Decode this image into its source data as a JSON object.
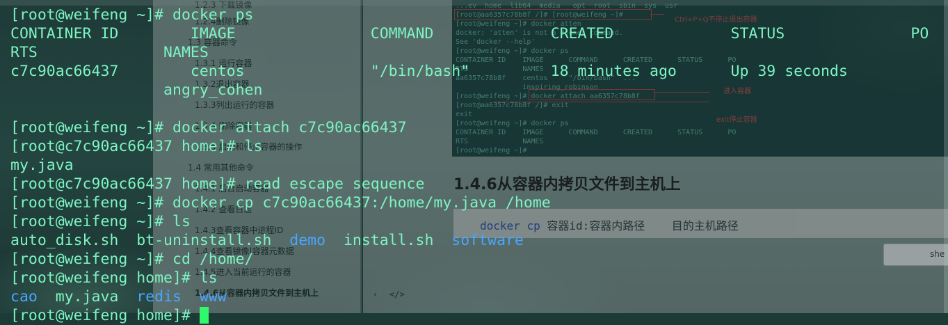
{
  "document": {
    "toc": [
      "1.2.3 下载镜像",
      "1.2.4删除镜像",
      "1.3 容器命令",
      "1.3.1 运行容器",
      "1.3.2退出容器",
      "1.3.3列出运行的容器",
      "1.3.4 删除容器",
      "1.3.5 启动和停止容器的操作",
      "1.4 常用其他命令",
      "1.4.1 后台启动容器",
      "1.4.2 查看日志",
      "1.4.3查看容器中进程ID",
      "1.4.4查看镜像|容器元数据",
      "1.4.5进入当前运行的容器",
      "1.4.6从容器内拷贝文件到主机上"
    ],
    "screenshot_lines": [
      "...ev  home  lib64  media   opt  root  sbin  sys  usr",
      "[root@aa6357c78b8f /]# [root@weifeng ~]#",
      "[root@weifeng ~]# docker atten",
      "docker: 'atten' is not a docker command.",
      "See 'docker --help'",
      "[root@weifeng ~]# docker ps",
      "CONTAINER ID    IMAGE      COMMAND      CREATED      STATUS      PO",
      "RTS             NAMES",
      "aa6357c78b8f    centos     \"/bin/bash\"  ...",
      "                inspiring_robinson",
      "[root@weifeng ~]# docker attach aa6357c78b8f",
      "[root@aa6357c78b8f /]# exit",
      "exit",
      "[root@weifeng ~]# docker ps",
      "CONTAINER ID    IMAGE      COMMAND      CREATED      STATUS      PO",
      "RTS             NAMES",
      "[root@weifeng ~]# "
    ],
    "screenshot_notes": {
      "note1": "Ctrl+P+Q不停止退出容器",
      "note2": "进入容器",
      "note3": "exit停止容器"
    },
    "heading": "1.4.6从容器内拷贝文件到主机上",
    "code": {
      "cmd": "docker",
      "sub": "cp",
      "rest": " 容器id:容器内路径    目的主机路径"
    },
    "button_label": "she",
    "footer_icons": [
      "‹",
      "</>"
    ]
  },
  "terminal": {
    "prompt_home": "[root@weifeng ~]# ",
    "lines": [
      {
        "text": "[root@weifeng ~]# docker ps"
      },
      {
        "text": "CONTAINER ID        IMAGE               COMMAND             CREATED             STATUS              PO"
      },
      {
        "text": "RTS              NAMES"
      },
      {
        "text": "c7c90ac66437        centos              \"/bin/bash\"         18 minutes ago      Up 39 seconds"
      },
      {
        "text": "                 angry_cohen"
      },
      {
        "text": ""
      },
      {
        "text": "[root@weifeng ~]# docker attach c7c90ac66437"
      },
      {
        "text": "[root@c7c90ac66437 home]# ls"
      },
      {
        "text": "my.java"
      },
      {
        "text": "[root@c7c90ac66437 home]# read escape sequence"
      },
      {
        "text": "[root@weifeng ~]# docker cp c7c90ac66437:/home/my.java /home"
      },
      {
        "text": "[root@weifeng ~]# ls"
      },
      {
        "parts": [
          {
            "text": "auto_disk.sh  bt-uninstall.sh  ",
            "dir": false
          },
          {
            "text": "demo",
            "dir": true
          },
          {
            "text": "  install.sh  ",
            "dir": false
          },
          {
            "text": "software",
            "dir": true
          }
        ]
      },
      {
        "text": "[root@weifeng ~]# cd /home/"
      },
      {
        "text": "[root@weifeng home]# ls"
      },
      {
        "parts": [
          {
            "text": "cao",
            "dir": true
          },
          {
            "text": "  my.java  ",
            "dir": false
          },
          {
            "text": "redis",
            "dir": true
          },
          {
            "text": "  ",
            "dir": false
          },
          {
            "text": "www",
            "dir": true
          }
        ]
      },
      {
        "text": "[root@weifeng home]# ",
        "cursor": true
      }
    ],
    "colors": {
      "text": "#7df5c2",
      "directory": "#4aa6ff",
      "cursor": "#2ff86a"
    }
  }
}
